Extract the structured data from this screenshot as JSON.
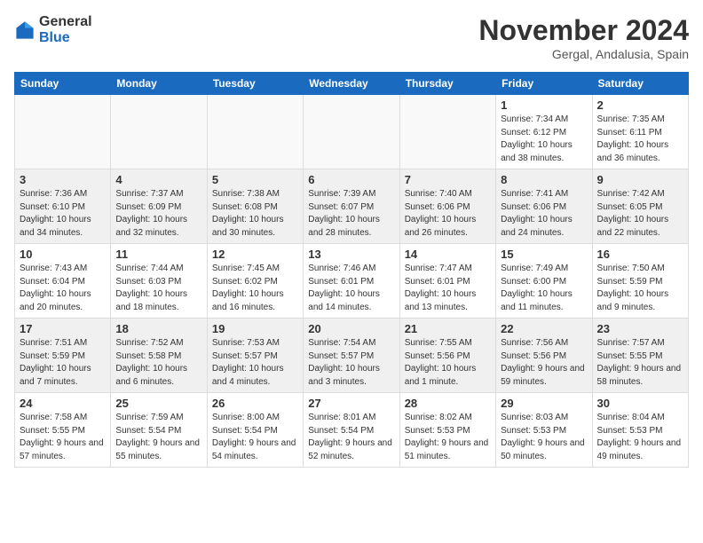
{
  "logo": {
    "general": "General",
    "blue": "Blue"
  },
  "title": {
    "month": "November 2024",
    "location": "Gergal, Andalusia, Spain"
  },
  "weekdays": [
    "Sunday",
    "Monday",
    "Tuesday",
    "Wednesday",
    "Thursday",
    "Friday",
    "Saturday"
  ],
  "weeks": [
    [
      {
        "day": "",
        "info": ""
      },
      {
        "day": "",
        "info": ""
      },
      {
        "day": "",
        "info": ""
      },
      {
        "day": "",
        "info": ""
      },
      {
        "day": "",
        "info": ""
      },
      {
        "day": "1",
        "info": "Sunrise: 7:34 AM\nSunset: 6:12 PM\nDaylight: 10 hours and 38 minutes."
      },
      {
        "day": "2",
        "info": "Sunrise: 7:35 AM\nSunset: 6:11 PM\nDaylight: 10 hours and 36 minutes."
      }
    ],
    [
      {
        "day": "3",
        "info": "Sunrise: 7:36 AM\nSunset: 6:10 PM\nDaylight: 10 hours and 34 minutes."
      },
      {
        "day": "4",
        "info": "Sunrise: 7:37 AM\nSunset: 6:09 PM\nDaylight: 10 hours and 32 minutes."
      },
      {
        "day": "5",
        "info": "Sunrise: 7:38 AM\nSunset: 6:08 PM\nDaylight: 10 hours and 30 minutes."
      },
      {
        "day": "6",
        "info": "Sunrise: 7:39 AM\nSunset: 6:07 PM\nDaylight: 10 hours and 28 minutes."
      },
      {
        "day": "7",
        "info": "Sunrise: 7:40 AM\nSunset: 6:06 PM\nDaylight: 10 hours and 26 minutes."
      },
      {
        "day": "8",
        "info": "Sunrise: 7:41 AM\nSunset: 6:06 PM\nDaylight: 10 hours and 24 minutes."
      },
      {
        "day": "9",
        "info": "Sunrise: 7:42 AM\nSunset: 6:05 PM\nDaylight: 10 hours and 22 minutes."
      }
    ],
    [
      {
        "day": "10",
        "info": "Sunrise: 7:43 AM\nSunset: 6:04 PM\nDaylight: 10 hours and 20 minutes."
      },
      {
        "day": "11",
        "info": "Sunrise: 7:44 AM\nSunset: 6:03 PM\nDaylight: 10 hours and 18 minutes."
      },
      {
        "day": "12",
        "info": "Sunrise: 7:45 AM\nSunset: 6:02 PM\nDaylight: 10 hours and 16 minutes."
      },
      {
        "day": "13",
        "info": "Sunrise: 7:46 AM\nSunset: 6:01 PM\nDaylight: 10 hours and 14 minutes."
      },
      {
        "day": "14",
        "info": "Sunrise: 7:47 AM\nSunset: 6:01 PM\nDaylight: 10 hours and 13 minutes."
      },
      {
        "day": "15",
        "info": "Sunrise: 7:49 AM\nSunset: 6:00 PM\nDaylight: 10 hours and 11 minutes."
      },
      {
        "day": "16",
        "info": "Sunrise: 7:50 AM\nSunset: 5:59 PM\nDaylight: 10 hours and 9 minutes."
      }
    ],
    [
      {
        "day": "17",
        "info": "Sunrise: 7:51 AM\nSunset: 5:59 PM\nDaylight: 10 hours and 7 minutes."
      },
      {
        "day": "18",
        "info": "Sunrise: 7:52 AM\nSunset: 5:58 PM\nDaylight: 10 hours and 6 minutes."
      },
      {
        "day": "19",
        "info": "Sunrise: 7:53 AM\nSunset: 5:57 PM\nDaylight: 10 hours and 4 minutes."
      },
      {
        "day": "20",
        "info": "Sunrise: 7:54 AM\nSunset: 5:57 PM\nDaylight: 10 hours and 3 minutes."
      },
      {
        "day": "21",
        "info": "Sunrise: 7:55 AM\nSunset: 5:56 PM\nDaylight: 10 hours and 1 minute."
      },
      {
        "day": "22",
        "info": "Sunrise: 7:56 AM\nSunset: 5:56 PM\nDaylight: 9 hours and 59 minutes."
      },
      {
        "day": "23",
        "info": "Sunrise: 7:57 AM\nSunset: 5:55 PM\nDaylight: 9 hours and 58 minutes."
      }
    ],
    [
      {
        "day": "24",
        "info": "Sunrise: 7:58 AM\nSunset: 5:55 PM\nDaylight: 9 hours and 57 minutes."
      },
      {
        "day": "25",
        "info": "Sunrise: 7:59 AM\nSunset: 5:54 PM\nDaylight: 9 hours and 55 minutes."
      },
      {
        "day": "26",
        "info": "Sunrise: 8:00 AM\nSunset: 5:54 PM\nDaylight: 9 hours and 54 minutes."
      },
      {
        "day": "27",
        "info": "Sunrise: 8:01 AM\nSunset: 5:54 PM\nDaylight: 9 hours and 52 minutes."
      },
      {
        "day": "28",
        "info": "Sunrise: 8:02 AM\nSunset: 5:53 PM\nDaylight: 9 hours and 51 minutes."
      },
      {
        "day": "29",
        "info": "Sunrise: 8:03 AM\nSunset: 5:53 PM\nDaylight: 9 hours and 50 minutes."
      },
      {
        "day": "30",
        "info": "Sunrise: 8:04 AM\nSunset: 5:53 PM\nDaylight: 9 hours and 49 minutes."
      }
    ]
  ]
}
